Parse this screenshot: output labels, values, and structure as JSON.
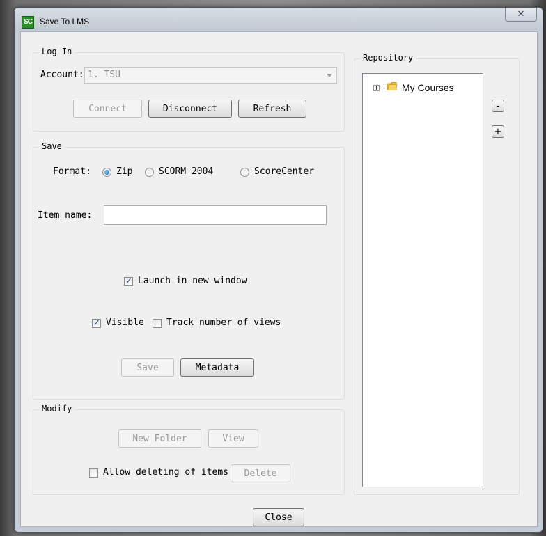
{
  "window": {
    "title": "Save To LMS",
    "icon_text": "SC",
    "close_glyph": "✕"
  },
  "login": {
    "group_label": "Log In",
    "account_label": "Account:",
    "account_value": "1. TSU",
    "connect_label": "Connect",
    "disconnect_label": "Disconnect",
    "refresh_label": "Refresh"
  },
  "save": {
    "group_label": "Save",
    "format_label": "Format:",
    "formats": [
      {
        "label": "Zip",
        "checked": true
      },
      {
        "label": "SCORM 2004",
        "checked": false
      },
      {
        "label": "ScoreCenter",
        "checked": false
      }
    ],
    "item_name_label": "Item name:",
    "item_name_value": "",
    "launch_label": "Launch in new window",
    "visible_label": "Visible",
    "track_label": "Track number of views",
    "save_label": "Save",
    "metadata_label": "Metadata"
  },
  "modify": {
    "group_label": "Modify",
    "new_folder_label": "New Folder",
    "view_label": "View",
    "allow_delete_label": "Allow deleting of items",
    "delete_label": "Delete"
  },
  "repository": {
    "group_label": "Repository",
    "tree_root_label": "My Courses",
    "collapse_label": "-",
    "expand_label": "+"
  },
  "footer": {
    "close_label": "Close"
  }
}
